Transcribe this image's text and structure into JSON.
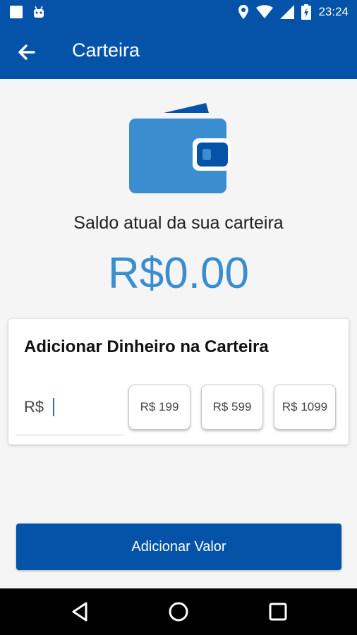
{
  "status_bar": {
    "time": "23:24"
  },
  "app_bar": {
    "title": "Carteira"
  },
  "wallet": {
    "balance_label": "Saldo atual da sua carteira",
    "balance": "R$0.00"
  },
  "add_money": {
    "title": "Adicionar Dinheiro na Carteira",
    "input_prefix": "R$",
    "input_value": "",
    "quick_amounts": [
      "R$ 199",
      "R$ 599",
      "R$ 1099"
    ]
  },
  "actions": {
    "add_value_label": "Adicionar Valor"
  },
  "colors": {
    "primary": "#0453a8",
    "accent": "#3a8ed0",
    "background": "#f5f5f5"
  },
  "icons": [
    "image-icon",
    "android-icon",
    "location-icon",
    "wifi-icon",
    "signal-icon",
    "battery-charging-icon",
    "back-arrow-icon",
    "wallet-icon",
    "nav-back-icon",
    "nav-home-icon",
    "nav-recents-icon"
  ]
}
